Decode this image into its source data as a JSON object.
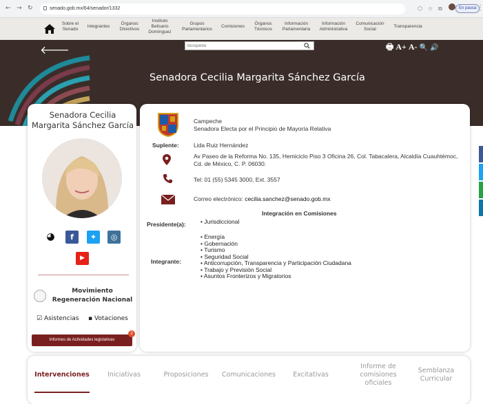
{
  "browser": {
    "url": "senado.gob.mx/64/senador/1332",
    "pause_label": "En pausa"
  },
  "menu": {
    "items": [
      {
        "label": "Sobre el Senado"
      },
      {
        "label": "Integrantes"
      },
      {
        "label": "Órganos Directivos"
      },
      {
        "label": "Instituto Belisario Domínguez"
      },
      {
        "label": "Grupos Parlamentarios"
      },
      {
        "label": "Comisiones"
      },
      {
        "label": "Órganos Técnicos"
      },
      {
        "label": "Información Parlamentaria"
      },
      {
        "label": "Información Administrativa"
      },
      {
        "label": "Comunicación Social"
      },
      {
        "label": "Transparencia"
      }
    ]
  },
  "search": {
    "placeholder": "Búsqueda"
  },
  "tools": {
    "print": "🖶",
    "increase": "A+",
    "decrease": "A-",
    "zoom": "🔍",
    "audio": "🔊"
  },
  "hero": {
    "title": "Senadora Cecilia Margarita Sánchez García"
  },
  "profile": {
    "name": "Senadora Cecilia Margarita Sánchez García",
    "party": "Movimiento Regeneración Nacional",
    "asistencias_label": "Asistencias",
    "votaciones_label": "Votaciones",
    "report_label": "Informes de Actividades legislativas",
    "report_badge": "2"
  },
  "info": {
    "state": "Campeche",
    "election": "Senadora Electa por el Principio de Mayoría Relativa",
    "suplente_label": "Suplente:",
    "suplente": "Lida Ruiz Hernández",
    "address": "Av Paseo de la Reforma No. 135, Hemiciclo Piso 3 Oficina 26, Col. Tabacalera, Alcaldía Cuauhtémoc, Cd. de México, C. P. 06030.",
    "phone": "Tel: 01 (55) 5345 3000, Ext. 3557",
    "email_prefix": "Correo electrónico:",
    "email": "cecilia.sanchez@senado.gob.mx",
    "commissions_title": "Integración en Comisiones",
    "president_label": "Presidente(a):",
    "president_items": [
      "Jurisdiccional"
    ],
    "member_label": "Integrante:",
    "member_items": [
      "Energía",
      "Gobernación",
      "Turismo",
      "Seguridad Social",
      "Anticorrupción, Transparencia y Participación Ciudadana",
      "Trabajo y Previsión Social",
      "Asuntos Fronterizos y Migratorios"
    ]
  },
  "tabs": [
    {
      "label": "Intervenciones",
      "active": true
    },
    {
      "label": "Iniciativas"
    },
    {
      "label": "Proposiciones"
    },
    {
      "label": "Comunicaciones"
    },
    {
      "label": "Excitativas"
    },
    {
      "label": "Informe de comisiones oficiales"
    },
    {
      "label": "Semblanza Curricular"
    }
  ],
  "colors": {
    "accent": "#7a1f1f",
    "facebook": "#3b5998",
    "twitter": "#1da1f2",
    "instagram": "#3f729b",
    "youtube": "#e62117"
  }
}
